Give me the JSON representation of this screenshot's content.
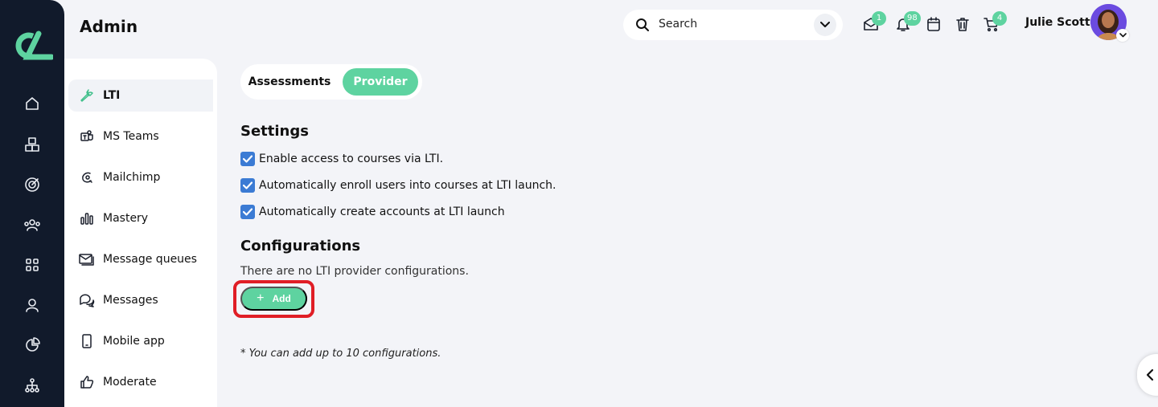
{
  "header": {
    "title": "Admin",
    "search_label": "Search",
    "badges": {
      "messages": "1",
      "notifications": "98",
      "cart": "4"
    },
    "user_name": "Julie Scott"
  },
  "subnav": {
    "items": [
      {
        "label": "LTI",
        "icon": "wrench-icon",
        "active": true
      },
      {
        "label": "MS Teams",
        "icon": "teams-icon"
      },
      {
        "label": "Mailchimp",
        "icon": "mailchimp-icon"
      },
      {
        "label": "Mastery",
        "icon": "bar-chart-icon"
      },
      {
        "label": "Message queues",
        "icon": "mail-queue-icon"
      },
      {
        "label": "Messages",
        "icon": "chat-icon"
      },
      {
        "label": "Mobile app",
        "icon": "mobile-icon"
      },
      {
        "label": "Moderate",
        "icon": "thumbs-up-icon"
      }
    ]
  },
  "tabs": {
    "assessments": "Assessments",
    "provider": "Provider",
    "active": "Provider"
  },
  "settings": {
    "heading": "Settings",
    "options": [
      {
        "label": "Enable access to courses via LTI.",
        "checked": true
      },
      {
        "label": "Automatically enroll users into courses at LTI launch.",
        "checked": true
      },
      {
        "label": "Automatically create accounts at LTI launch",
        "checked": true
      }
    ]
  },
  "configurations": {
    "heading": "Configurations",
    "empty_message": "There are no LTI provider configurations.",
    "add_label": "Add",
    "footnote": "* You can add up to 10 configurations."
  },
  "colors": {
    "rail": "#111a2b",
    "accent": "#5ed3a0",
    "checkbox": "#3b7bd4",
    "highlight": "#e01e26"
  }
}
